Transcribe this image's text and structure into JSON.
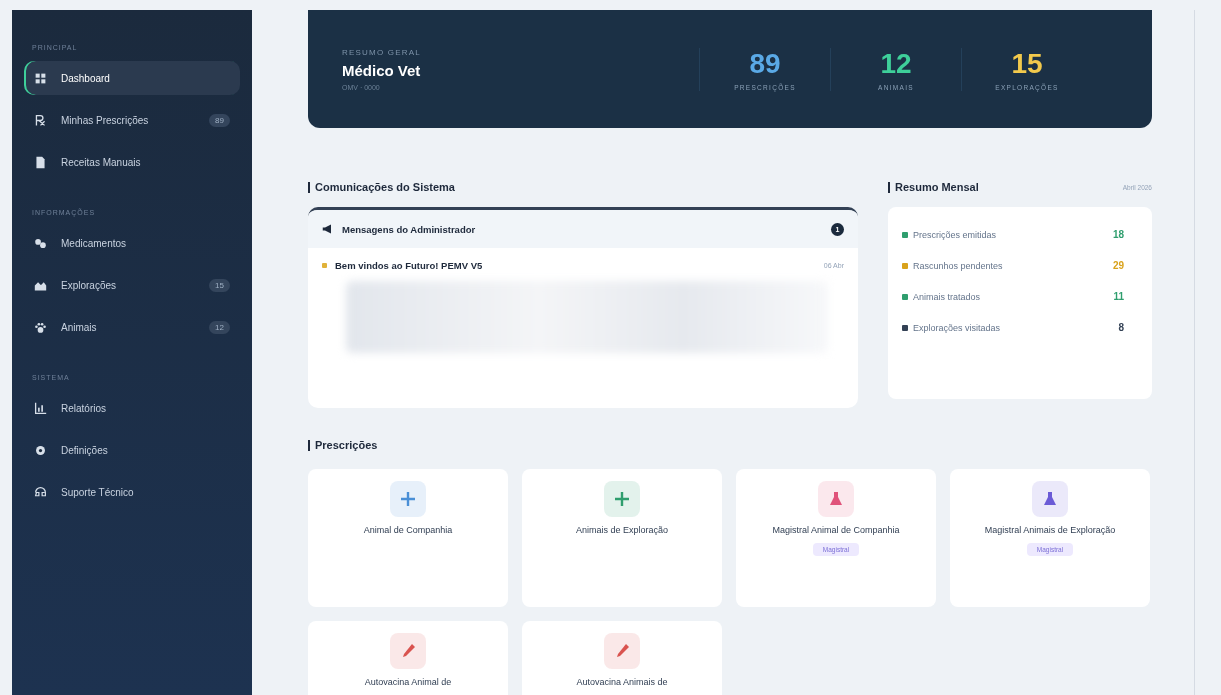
{
  "sidebar": {
    "sections": [
      {
        "title": "PRINCIPAL",
        "items": [
          {
            "label": "Dashboard",
            "kind": "grid",
            "selected": true
          },
          {
            "label": "Minhas Prescrições",
            "kind": "rx",
            "selected": false,
            "badge": "89"
          },
          {
            "label": "Receitas Manuais",
            "kind": "doc",
            "selected": false
          }
        ]
      },
      {
        "title": "INFORMAÇÕES",
        "items": [
          {
            "label": "Medicamentos",
            "kind": "pills",
            "selected": false
          },
          {
            "label": "Explorações",
            "kind": "barn",
            "selected": false,
            "badge": "15"
          },
          {
            "label": "Animais",
            "kind": "paw",
            "selected": false,
            "badge": "12"
          }
        ]
      },
      {
        "title": "SISTEMA",
        "items": [
          {
            "label": "Relatórios",
            "kind": "chart",
            "selected": false
          },
          {
            "label": "Definições",
            "kind": "gear",
            "selected": false
          },
          {
            "label": "Suporte Técnico",
            "kind": "support",
            "selected": false
          }
        ]
      }
    ]
  },
  "summary": {
    "eyebrow": "RESUMO GERAL",
    "name": "Médico Vet",
    "license": "OMV · 0000",
    "stats": [
      {
        "value": "89",
        "label": "PRESCRIÇÕES",
        "color": "#5aa9e6"
      },
      {
        "value": "12",
        "label": "ANIMAIS",
        "color": "#3ecf9a"
      },
      {
        "value": "15",
        "label": "EXPLORAÇÕES",
        "color": "#f2c94c"
      }
    ]
  },
  "communications": {
    "title": "Comunicações do Sistema",
    "panel_title": "Mensagens do Administrador",
    "count": "1",
    "messages": [
      {
        "title": "Bem vindos ao Futuro! PEMV V5",
        "date": "06 Abr",
        "color": "#e0b23a"
      }
    ]
  },
  "monthly": {
    "title": "Resumo Mensal",
    "period": "Abril 2026",
    "rows": [
      {
        "label": "Prescrições emitidas",
        "value": "18",
        "color": "#2f9e6e"
      },
      {
        "label": "Rascunhos pendentes",
        "value": "29",
        "color": "#d9a21b"
      },
      {
        "label": "Animais tratados",
        "value": "11",
        "color": "#2f9e6e"
      },
      {
        "label": "Explorações visitadas",
        "value": "8",
        "color": "#334155"
      }
    ]
  },
  "prescriptions": {
    "title": "Prescrições",
    "cards": [
      {
        "label": "Animal de Companhia",
        "kind": "plus",
        "color": "#4a8fd6"
      },
      {
        "label": "Animais de Exploração",
        "kind": "plus",
        "color": "#2f9e6e"
      },
      {
        "label": "Magistral Animal de Companhia",
        "kind": "flask",
        "color": "#e0527a",
        "tag": "Magistral"
      },
      {
        "label": "Magistral Animais de Exploração",
        "kind": "flask",
        "color": "#6b5bd6",
        "tag": "Magistral"
      },
      {
        "label": "Autovacina Animal de",
        "kind": "syringe",
        "color": "#d9534f"
      },
      {
        "label": "Autovacina Animais de",
        "kind": "syringe",
        "color": "#d9534f"
      }
    ]
  }
}
